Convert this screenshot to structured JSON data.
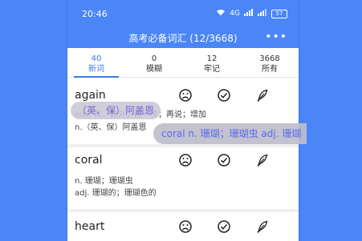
{
  "status": {
    "time": "20:46",
    "network": "4G",
    "battery": "57"
  },
  "titlebar": {
    "title": "高考必备词汇 (12/3668)"
  },
  "tabs": [
    {
      "num": "40",
      "label": "新词"
    },
    {
      "num": "0",
      "label": "模糊"
    },
    {
      "num": "12",
      "label": "牢记"
    },
    {
      "num": "3668",
      "label": "所有"
    }
  ],
  "cards": [
    {
      "word": "again",
      "def1": "adv. 又，此外；再一次；再说；增加",
      "def2": "n.（英、保）阿盖恩"
    },
    {
      "word": "coral",
      "def1": "n. 珊瑚；珊瑚虫",
      "def2": "adj. 珊瑚的；珊瑚色的"
    },
    {
      "word": "heart"
    }
  ],
  "overlay": {
    "bubble_left": "（英、保）阿盖恩",
    "bubble_right": "coral  n. 珊瑚；珊瑚虫 adj. 珊瑚"
  },
  "icons": [
    "sad-face-icon",
    "check-circle-icon",
    "feather-pen-icon",
    "more-dots-icon"
  ]
}
